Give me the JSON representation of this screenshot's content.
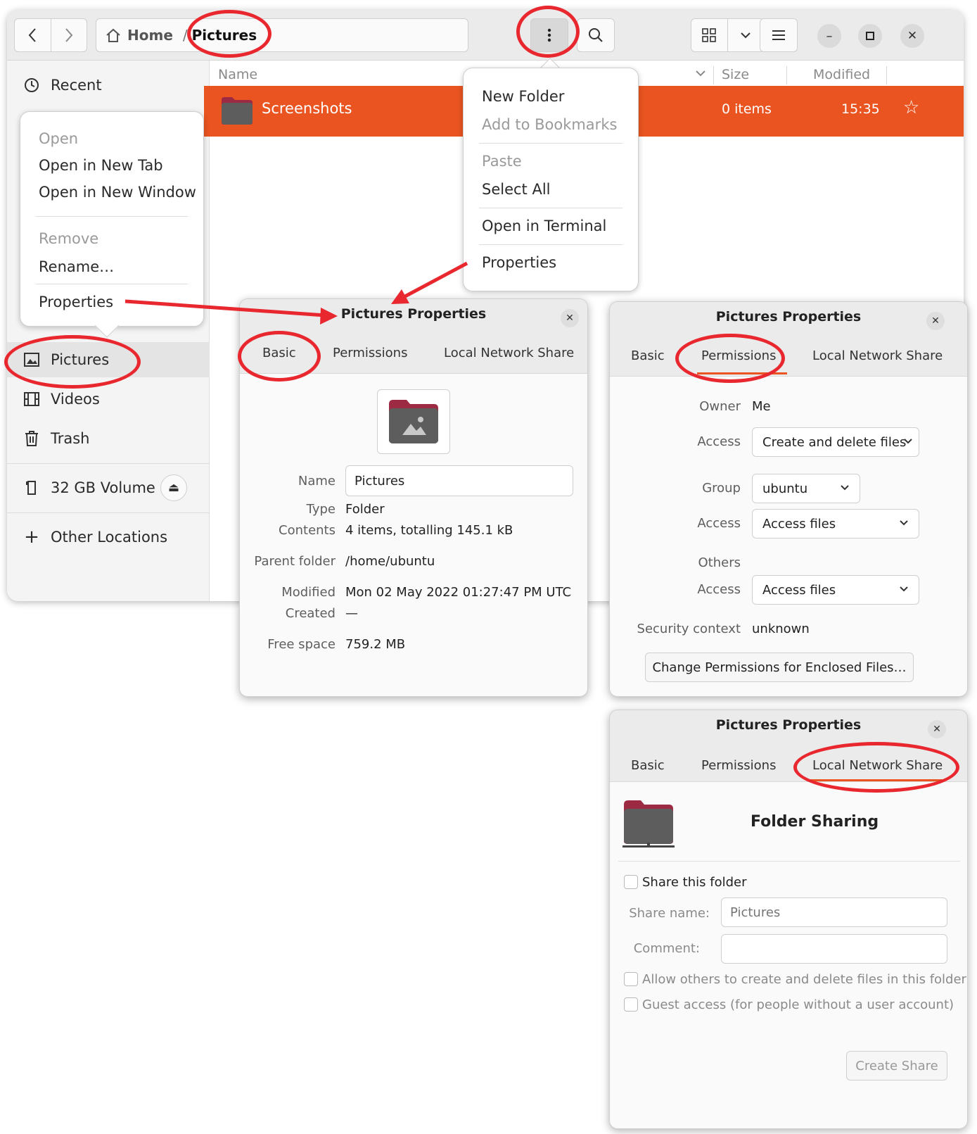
{
  "colors": {
    "accent": "#e95420",
    "annotation": "#e8282e",
    "folder_dark": "#5d5d5d",
    "folder_tab": "#9c2a43"
  },
  "headerbar": {
    "breadcrumb": {
      "home": "Home",
      "separator": "/",
      "current": "Pictures"
    },
    "icons": [
      "back-icon",
      "forward-icon",
      "home-icon",
      "more-vertical-icon",
      "search-icon",
      "grid-view-icon",
      "chevron-down-icon",
      "hamburger-menu-icon",
      "minimize-icon",
      "maximize-icon",
      "close-icon"
    ],
    "minimize_glyph": "–",
    "close_glyph": "✕"
  },
  "sidebar": {
    "items": [
      {
        "label": "Recent",
        "icon": "clock-icon"
      },
      {
        "label": "Pictures",
        "icon": "image-icon"
      },
      {
        "label": "Videos",
        "icon": "film-icon"
      },
      {
        "label": "Trash",
        "icon": "trash-icon"
      },
      {
        "label": "32 GB Volume",
        "icon": "drive-icon"
      },
      {
        "label": "Other Locations",
        "icon": "plus-icon"
      }
    ],
    "eject_glyph": "⏏",
    "plus_glyph": "+"
  },
  "file_list": {
    "columns": {
      "name": "Name",
      "size": "Size",
      "modified": "Modified"
    },
    "rows": [
      {
        "name": "Screenshots",
        "size": "0 items",
        "modified": "15:35",
        "starred_glyph": "☆"
      }
    ]
  },
  "context_menu": {
    "items": [
      {
        "label": "Open",
        "enabled": false
      },
      {
        "label": "Open in New Tab",
        "enabled": true
      },
      {
        "label": "Open in New Window",
        "enabled": true
      },
      {
        "label": "Remove",
        "enabled": false
      },
      {
        "label": "Rename…",
        "enabled": true
      },
      {
        "label": "Properties",
        "enabled": true
      }
    ]
  },
  "folder_menu": {
    "items": [
      {
        "label": "New Folder",
        "enabled": true
      },
      {
        "label": "Add to Bookmarks",
        "enabled": false
      },
      {
        "label": "Paste",
        "enabled": false
      },
      {
        "label": "Select All",
        "enabled": true
      },
      {
        "label": "Open in Terminal",
        "enabled": true
      },
      {
        "label": "Properties",
        "enabled": true
      }
    ]
  },
  "dialog_title": "Pictures Properties",
  "dialog_close_glyph": "✕",
  "tabs": {
    "basic": "Basic",
    "permissions": "Permissions",
    "share": "Local Network Share"
  },
  "basic": {
    "name_label": "Name",
    "name_value": "Pictures",
    "type_label": "Type",
    "type_value": "Folder",
    "contents_label": "Contents",
    "contents_value": "4 items, totalling 145.1 kB",
    "parent_label": "Parent folder",
    "parent_value": "/home/ubuntu",
    "modified_label": "Modified",
    "modified_value": "Mon 02 May 2022 01:27:47 PM UTC",
    "created_label": "Created",
    "created_value": "—",
    "free_label": "Free space",
    "free_value": "759.2 MB"
  },
  "permissions": {
    "owner_label": "Owner",
    "owner_value": "Me",
    "access_label": "Access",
    "owner_access": "Create and delete files",
    "group_label": "Group",
    "group_value": "ubuntu",
    "group_access": "Access files",
    "others_label": "Others",
    "others_access": "Access files",
    "security_label": "Security context",
    "security_value": "unknown",
    "change_button": "Change Permissions for Enclosed Files…"
  },
  "share": {
    "heading": "Folder Sharing",
    "share_checkbox": "Share this folder",
    "share_name_label": "Share name:",
    "share_name_placeholder": "Pictures",
    "comment_label": "Comment:",
    "allow_checkbox": "Allow others to create and delete files in this folder",
    "guest_checkbox": "Guest access (for people without a user account)",
    "create_button": "Create Share"
  }
}
